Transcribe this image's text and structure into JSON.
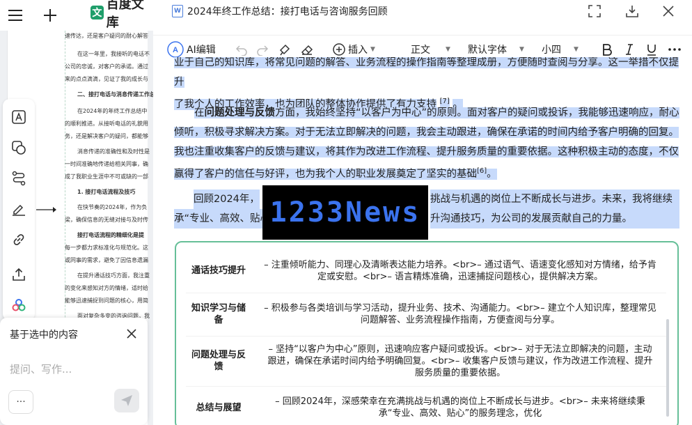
{
  "app": {
    "logo_text": "百度文库",
    "logo_mark": "文"
  },
  "doc": {
    "title": "2024年终工作总结：接打电话与咨询服务回顾"
  },
  "thumbnail": {
    "lines": [
      {
        "text": "速传达，还是客户疑问的耐心解答",
        "bold": false
      },
      {
        "text": "在这一年里，我接听的电话不",
        "bold": false
      },
      {
        "text": "公司的忠诚，对客户的承诺。通过",
        "bold": false
      },
      {
        "text": "来的点点滴滴，见证了我的成长与",
        "bold": false
      },
      {
        "text": "二、接打电话与消息传递工作总",
        "bold": true
      },
      {
        "text": "在2024年的年终工作总结中",
        "bold": false
      },
      {
        "text": "的顺利推进。从接听电话的礼貌用",
        "bold": false
      },
      {
        "text": "务，还是解决客户的疑问，都能够",
        "bold": false
      },
      {
        "text": "消息传递的准确性和及时性是",
        "bold": false
      },
      {
        "text": "一时间准确地传递给相关同事，确",
        "bold": false
      },
      {
        "text": "成了我职业生涯中不可或缺的一部",
        "bold": false
      },
      {
        "text": "1. 接打电话流程及技巧",
        "bold": true
      },
      {
        "text": "在快节奏的2024年，作为负",
        "bold": false
      },
      {
        "text": "梁，确保信息的无缝对接与及时传",
        "bold": false
      },
      {
        "text": "接打电话流程的精细化是提",
        "bold": true
      },
      {
        "text": "每一步都力求标准化与规范化。这",
        "bold": false
      },
      {
        "text": "或同事的需求，避免了因信息遗漏",
        "bold": false
      },
      {
        "text": "在提升通话技巧方面，我注重",
        "bold": false
      },
      {
        "text": "的变化来感知对方的情绪，适时给",
        "bold": false
      },
      {
        "text": "能够迅速捕捉到问题的核心，用简",
        "bold": false
      },
      {
        "text": "面对复杂多变的咨询问题，我",
        "bold": false
      }
    ]
  },
  "toolbar": {
    "ai_edit": "AI编辑",
    "insert": "插入",
    "style": "正文",
    "font": "默认字体",
    "size": "小四"
  },
  "paragraphs": {
    "p1_line1": "业于自己的知识库，将常见问题的解答、业务流程的操作指南等整理成册，方便随时查阅与分享。这一举措不仅提升",
    "p1_line2": "了我个人的工作效率，也为团队的整体协作提供了有力支持",
    "p1_ref": "[7]",
    "p1_end": "。",
    "p2_prefix": "在",
    "p2_bold": "问题处理与反馈",
    "p2_text": "方面，我始终坚持“以客户为中心”的原则。面对客户的疑问或投诉，我能够迅速响应，耐心倾听，积极寻求解决方案。对于无法立即解决的问题，我会主动跟进，确保在承诺的时间内给予客户明确的回复。我也注重收集客户的反馈与建议，将其作为改进工作流程、提升服务质量的重要依据。这种积极主动的态度，不仅赢得了客户的信任与好评，也为我个人的职业发展奠定了坚实的基础",
    "p2_ref": "[6]",
    "p2_end": "。",
    "p3_line1_a": "回顾2024年，",
    "p3_line1_b": "挑战与机遇的岗位上不断成长与进步。未来，我将继续秉",
    "p3_line2_a": "承“专业、高效、贴心",
    "p3_line2_b": "升沟通技巧，为公司的发展贡献自己的力量。"
  },
  "watermark": {
    "text": "1233News"
  },
  "table": {
    "rows": [
      {
        "label": "通话技巧提升",
        "content": "– 注重倾听能力、同理心及清晰表达能力培养。<br>– 通过语气、语速变化感知对方情绪，给予肯定或安慰。<br>– 语言精炼准确，迅速捕捉问题核心，提供解决方案。"
      },
      {
        "label": "知识学习与储备",
        "content": "– 积极参与各类培训与学习活动，提升业务、技术、沟通能力。<br>– 建立个人知识库，整理常见问题解答、业务流程操作指南，方便查阅与分享。"
      },
      {
        "label": "问题处理与反馈",
        "content": "– 坚持“以客户为中心”原则，迅速响应客户疑问或投诉。<br>– 对于无法立即解决的问题，主动跟进，确保在承诺时间内给予明确回复。<br>– 收集客户反馈与建议，作为改进工作流程、提升服务质量的重要依据。"
      },
      {
        "label": "总结与展望",
        "content": "– 回顾2024年，深感荣幸在充满挑战与机遇的岗位上不断成长与进步。<br>– 未来将继续秉承“专业、高效、贴心”的服务理念，优化"
      }
    ]
  },
  "ai_panel": {
    "title": "基于选中的内容",
    "placeholder": "提问、写作...",
    "more": "···"
  },
  "colors": {
    "selection": "#c7dafb",
    "accent_green": "#66bf98",
    "watermark_blue": "#3b73ee"
  }
}
